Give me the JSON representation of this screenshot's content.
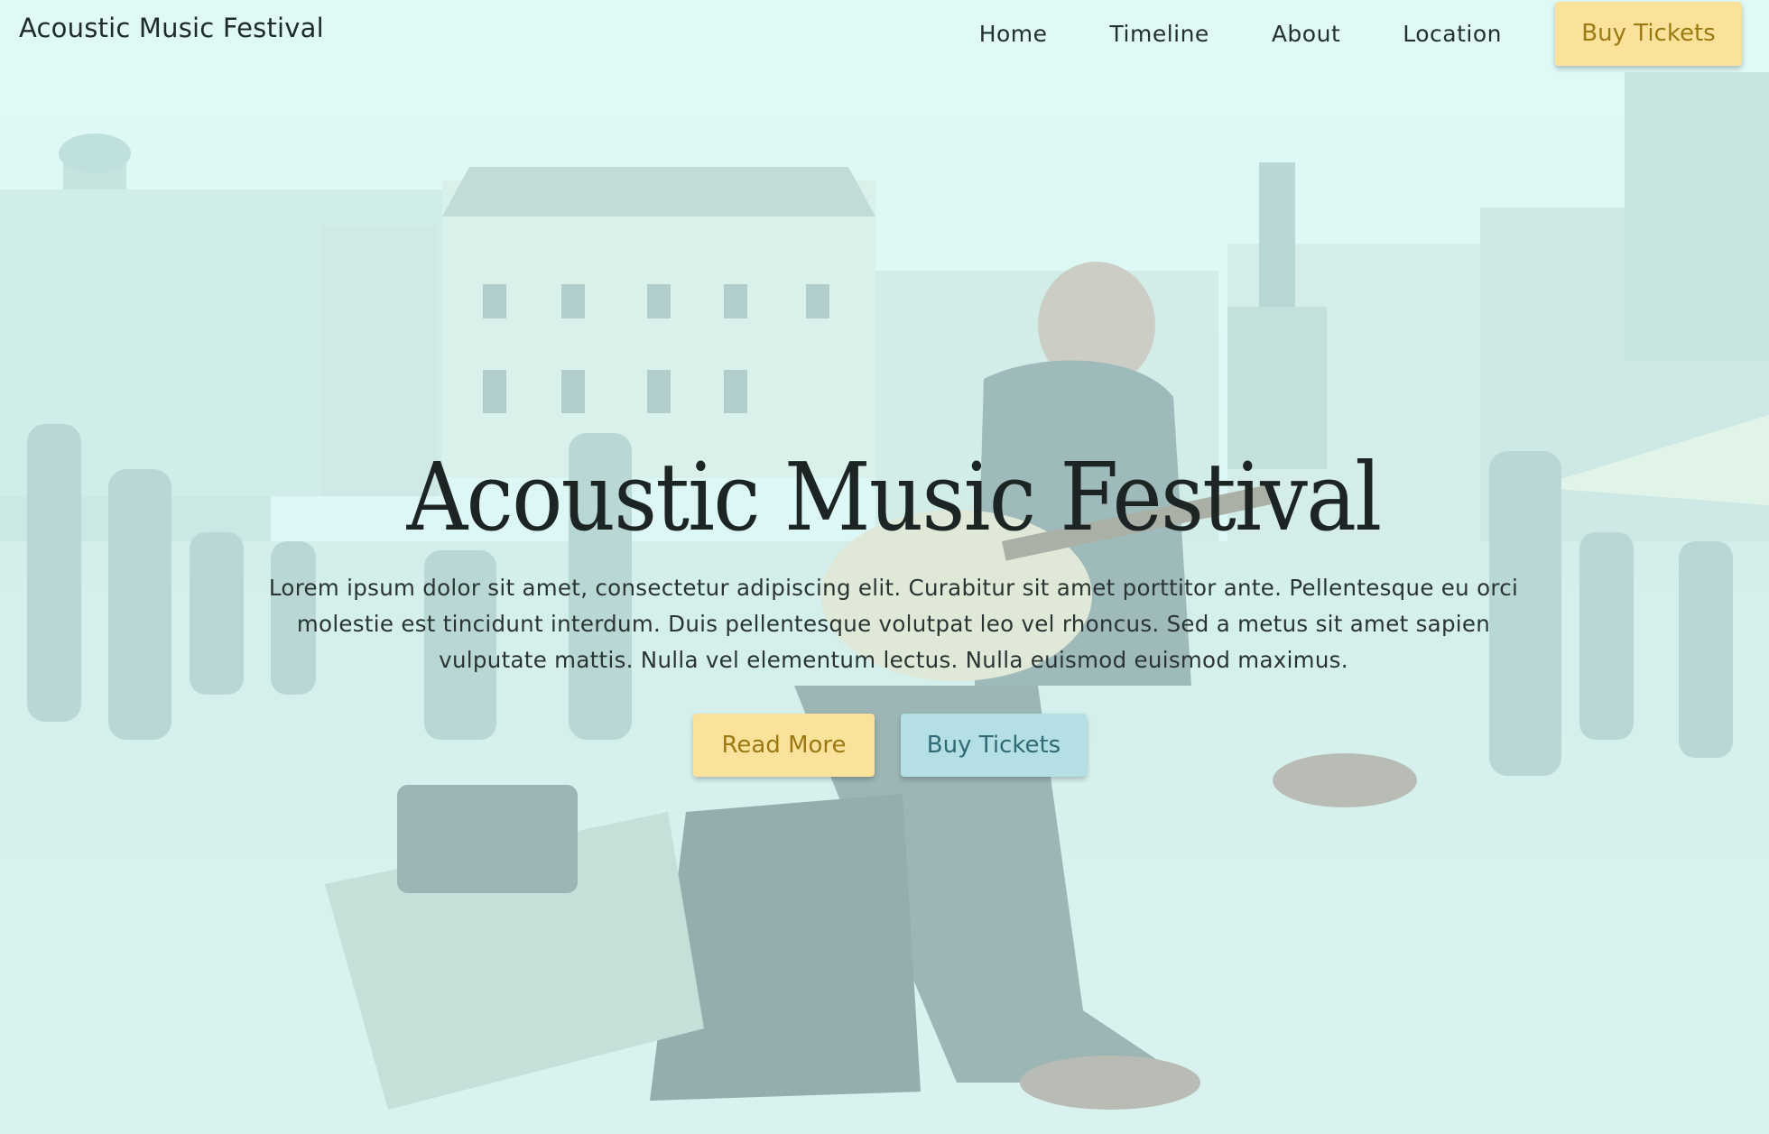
{
  "nav": {
    "brand": "Acoustic Music Festival",
    "links": [
      "Home",
      "Timeline",
      "About",
      "Location"
    ],
    "cta": "Buy Tickets"
  },
  "hero": {
    "title": "Acoustic Music Festival",
    "text": "Lorem ipsum dolor sit amet, consectetur adipiscing elit. Curabitur sit amet porttitor ante. Pellentesque eu orci molestie est tincidunt interdum. Duis pellentesque volutpat leo vel rhoncus. Sed a metus sit amet sapien vulputate mattis. Nulla vel elementum lectus. Nulla euismod euismod maximus.",
    "primary_button": "Read More",
    "secondary_button": "Buy Tickets",
    "background": "street-musician-photo"
  },
  "colors": {
    "overlay": "#dff6f4",
    "accent_yellow": "#fbe29a",
    "accent_yellow_text": "#9b7a14",
    "accent_blue": "#b3dfe5",
    "accent_blue_text": "#2f6a75"
  }
}
